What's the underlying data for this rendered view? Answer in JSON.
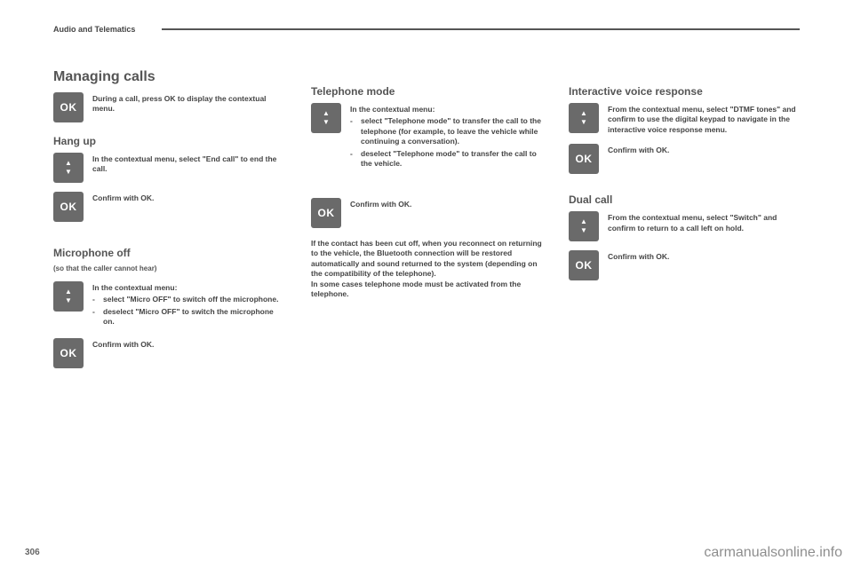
{
  "header": {
    "section": "Audio and Telematics"
  },
  "pageNumber": "306",
  "watermark": "carmanualsonline.info",
  "col1": {
    "heading": "Managing calls",
    "intro": "During a call, press OK to display the contextual menu.",
    "hangup": {
      "title": "Hang up",
      "step1": "In the contextual menu, select \"End call\" to end the call.",
      "step2": "Confirm with OK."
    },
    "micoff": {
      "title": "Microphone off",
      "note": "(so that the caller cannot hear)",
      "intro": "In the contextual menu:",
      "b1": "select \"Micro OFF\" to switch off the microphone.",
      "b2": "deselect \"Micro OFF\" to switch the microphone on.",
      "step2": "Confirm with OK."
    }
  },
  "col2": {
    "telmode": {
      "title": "Telephone mode",
      "intro": "In the contextual menu:",
      "b1": "select \"Telephone mode\" to transfer the call to the telephone (for example, to leave the vehicle while continuing a conversation).",
      "b2": "deselect \"Telephone mode\" to transfer the call to the vehicle.",
      "step2": "Confirm with OK.",
      "para": "If the contact has been cut off, when you reconnect on returning to the vehicle, the Bluetooth connection will be restored automatically and sound returned to the system (depending on the compatibility of the telephone).\nIn some cases telephone mode must be activated from the telephone."
    }
  },
  "col3": {
    "ivr": {
      "title": "Interactive voice response",
      "step1": "From the contextual menu, select \"DTMF tones\" and confirm to use the digital keypad to navigate in the interactive voice response menu.",
      "step2": "Confirm with OK."
    },
    "dual": {
      "title": "Dual call",
      "step1": "From the contextual menu, select \"Switch\" and confirm to return to a call left on hold.",
      "step2": "Confirm with OK."
    }
  }
}
